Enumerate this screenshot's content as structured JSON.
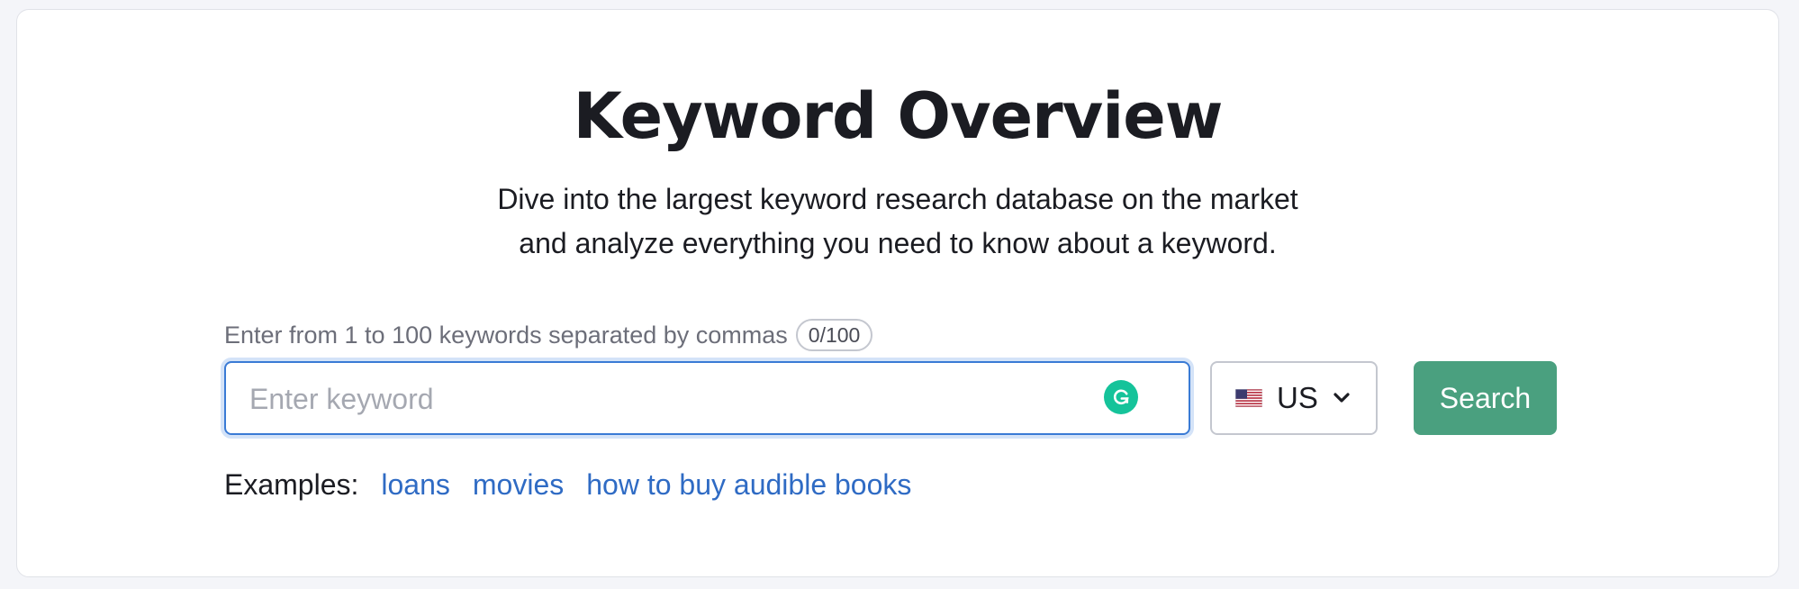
{
  "page": {
    "title": "Keyword Overview",
    "subtitle_line1": "Dive into the largest keyword research database on the market",
    "subtitle_line2": "and analyze everything you need to know about a keyword."
  },
  "form": {
    "hint": "Enter from 1 to 100 keywords separated by commas",
    "counter": "0/100",
    "input_value": "",
    "input_placeholder": "Enter keyword",
    "assistant_icon": "grammarly-icon",
    "database": {
      "selected": "US",
      "flag_icon": "us-flag-icon"
    },
    "search_label": "Search"
  },
  "examples": {
    "label": "Examples:",
    "items": [
      "loans",
      "movies",
      "how to buy audible books"
    ]
  },
  "colors": {
    "primary_button": "#4aa07f",
    "link": "#2f6bc4",
    "focus_border": "#3a7bd5",
    "grammarly": "#15c39a"
  }
}
